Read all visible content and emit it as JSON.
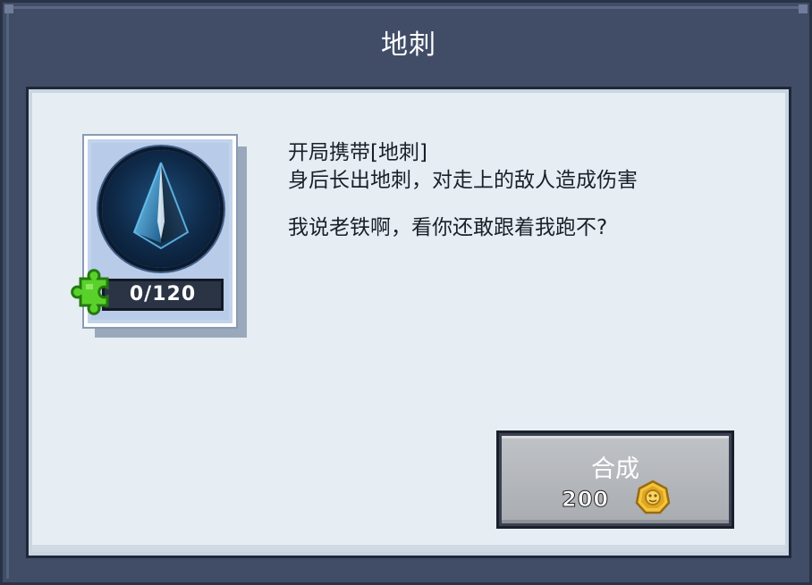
{
  "title": "地刺",
  "card": {
    "icon": "ground-spike-icon",
    "progress": "0/120",
    "progress_fraction": 0.0,
    "puzzle_icon": "puzzle-piece-icon"
  },
  "description": {
    "line1": "开局携带[地刺]",
    "line2": "身后长出地刺，对走上的敌人造成伤害",
    "flavor": "我说老铁啊，看你还敢跟着我跑不?"
  },
  "craft_button": {
    "label": "合成",
    "cost": "200",
    "currency_icon": "gold-coin-icon"
  },
  "colors": {
    "frame": "#414d67",
    "panel": "#e6eef4",
    "puzzle": "#5ad12a",
    "button": "#b3b6bb",
    "coin": "#f2c53d"
  }
}
